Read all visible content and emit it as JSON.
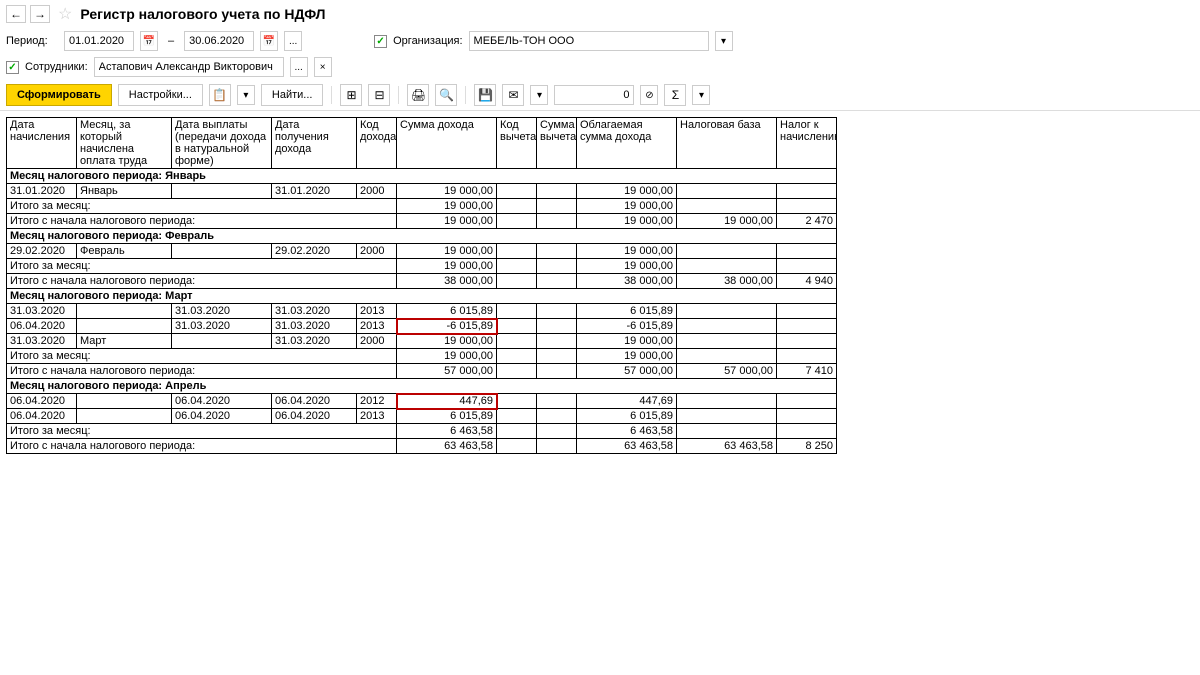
{
  "header": {
    "title": "Регистр налогового учета по НДФЛ"
  },
  "period": {
    "label": "Период:",
    "from": "01.01.2020",
    "to": "30.06.2020"
  },
  "org": {
    "label": "Организация:",
    "value": "МЕБЕЛЬ-ТОН ООО"
  },
  "employee": {
    "label": "Сотрудники:",
    "value": "Астапович Александр Викторович"
  },
  "toolbar": {
    "form": "Сформировать",
    "settings": "Настройки...",
    "find": "Найти...",
    "zero": "0",
    "sigma": "Σ"
  },
  "columns": {
    "c1": "Дата начисления",
    "c2": "Месяц, за который начислена оплата труда",
    "c3": "Дата выплаты (передачи дохода в натуральной форме)",
    "c4": "Дата получения дохода",
    "c5": "Код дохода",
    "c6": "Сумма дохода",
    "c7": "Код вычета",
    "c8": "Сумма вычета",
    "c9": "Облагаемая сумма дохода",
    "c10": "Налоговая база",
    "c11": "Налог к начислению"
  },
  "labels": {
    "sec_jan": "Месяц налогового периода: Январь",
    "sec_feb": "Месяц налогового периода: Февраль",
    "sec_mar": "Месяц налогового периода: Март",
    "sec_apr": "Месяц налогового периода: Апрель",
    "month_total": "Итого за месяц:",
    "period_total": "Итого с начала налогового периода:",
    "jan": "Январь",
    "feb": "Февраль",
    "mar": "Март"
  },
  "data": {
    "jan": {
      "r1": {
        "d": "31.01.2020",
        "dp": "31.01.2020",
        "code": "2000",
        "sum": "19 000,00",
        "tax": "19 000,00"
      },
      "mt": {
        "sum": "19 000,00",
        "tax": "19 000,00"
      },
      "pt": {
        "sum": "19 000,00",
        "tax": "19 000,00",
        "base": "19 000,00",
        "nal": "2 470"
      }
    },
    "feb": {
      "r1": {
        "d": "29.02.2020",
        "dp": "29.02.2020",
        "code": "2000",
        "sum": "19 000,00",
        "tax": "19 000,00"
      },
      "mt": {
        "sum": "19 000,00",
        "tax": "19 000,00"
      },
      "pt": {
        "sum": "38 000,00",
        "tax": "38 000,00",
        "base": "38 000,00",
        "nal": "4 940"
      }
    },
    "mar": {
      "r1": {
        "d": "31.03.2020",
        "dv": "31.03.2020",
        "dp": "31.03.2020",
        "code": "2013",
        "sum": "6 015,89",
        "tax": "6 015,89"
      },
      "r2": {
        "d": "06.04.2020",
        "dv": "31.03.2020",
        "dp": "31.03.2020",
        "code": "2013",
        "sum": "-6 015,89",
        "tax": "-6 015,89"
      },
      "r3": {
        "d": "31.03.2020",
        "dp": "31.03.2020",
        "code": "2000",
        "sum": "19 000,00",
        "tax": "19 000,00"
      },
      "mt": {
        "sum": "19 000,00",
        "tax": "19 000,00"
      },
      "pt": {
        "sum": "57 000,00",
        "tax": "57 000,00",
        "base": "57 000,00",
        "nal": "7 410"
      }
    },
    "apr": {
      "r1": {
        "d": "06.04.2020",
        "dv": "06.04.2020",
        "dp": "06.04.2020",
        "code": "2012",
        "sum": "447,69",
        "tax": "447,69"
      },
      "r2": {
        "d": "06.04.2020",
        "dv": "06.04.2020",
        "dp": "06.04.2020",
        "code": "2013",
        "sum": "6 015,89",
        "tax": "6 015,89"
      },
      "mt": {
        "sum": "6 463,58",
        "tax": "6 463,58"
      },
      "pt": {
        "sum": "63 463,58",
        "tax": "63 463,58",
        "base": "63 463,58",
        "nal": "8 250"
      }
    }
  }
}
